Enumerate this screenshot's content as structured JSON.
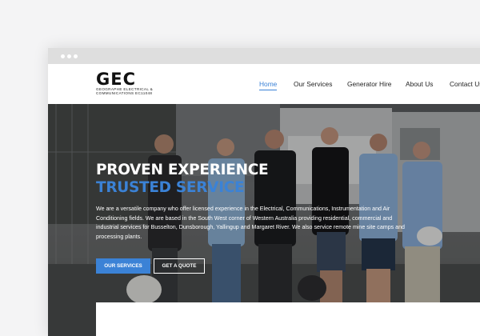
{
  "site": {
    "logo": {
      "mark": "GEC",
      "line1": "GEOGRAPHE ELECTRICAL &",
      "line2": "COMMUNICATIONS EC11048"
    },
    "nav": [
      {
        "label": "Home",
        "active": true
      },
      {
        "label": "Our Services",
        "active": false
      },
      {
        "label": "Generator Hire",
        "active": false
      },
      {
        "label": "About Us",
        "active": false
      },
      {
        "label": "Contact Us",
        "active": false
      }
    ]
  },
  "hero": {
    "headline": "PROVEN EXPERIENCE",
    "subheadline": "TRUSTED SERVICE",
    "description": "We are a versatile company who offer licensed experience in the Electrical, Communications, Instrumentation and Air Conditioning fields. We are based in the South West corner of Western Australia providing residential, commercial and industrial services for Busselton, Dunsborough, Yallingup and Margaret River. We also service remote mine site camps and processing plants.",
    "buttons": {
      "primary": "OUR SERVICES",
      "secondary": "GET A QUOTE"
    }
  },
  "colors": {
    "accent": "#3b82d6",
    "text_dark": "#1f1f1f",
    "page_bg": "#f4f4f5"
  }
}
